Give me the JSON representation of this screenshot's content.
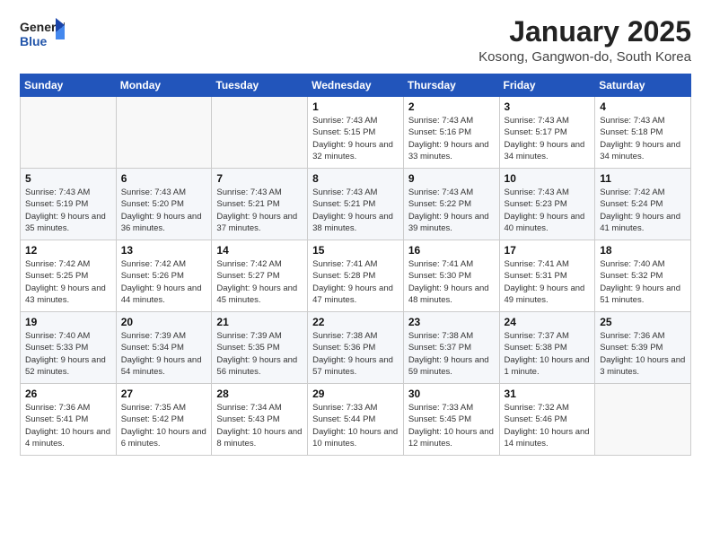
{
  "header": {
    "logo_general": "General",
    "logo_blue": "Blue",
    "title": "January 2025",
    "subtitle": "Kosong, Gangwon-do, South Korea"
  },
  "weekdays": [
    "Sunday",
    "Monday",
    "Tuesday",
    "Wednesday",
    "Thursday",
    "Friday",
    "Saturday"
  ],
  "weeks": [
    [
      {
        "day": "",
        "info": ""
      },
      {
        "day": "",
        "info": ""
      },
      {
        "day": "",
        "info": ""
      },
      {
        "day": "1",
        "info": "Sunrise: 7:43 AM\nSunset: 5:15 PM\nDaylight: 9 hours and 32 minutes."
      },
      {
        "day": "2",
        "info": "Sunrise: 7:43 AM\nSunset: 5:16 PM\nDaylight: 9 hours and 33 minutes."
      },
      {
        "day": "3",
        "info": "Sunrise: 7:43 AM\nSunset: 5:17 PM\nDaylight: 9 hours and 34 minutes."
      },
      {
        "day": "4",
        "info": "Sunrise: 7:43 AM\nSunset: 5:18 PM\nDaylight: 9 hours and 34 minutes."
      }
    ],
    [
      {
        "day": "5",
        "info": "Sunrise: 7:43 AM\nSunset: 5:19 PM\nDaylight: 9 hours and 35 minutes."
      },
      {
        "day": "6",
        "info": "Sunrise: 7:43 AM\nSunset: 5:20 PM\nDaylight: 9 hours and 36 minutes."
      },
      {
        "day": "7",
        "info": "Sunrise: 7:43 AM\nSunset: 5:21 PM\nDaylight: 9 hours and 37 minutes."
      },
      {
        "day": "8",
        "info": "Sunrise: 7:43 AM\nSunset: 5:21 PM\nDaylight: 9 hours and 38 minutes."
      },
      {
        "day": "9",
        "info": "Sunrise: 7:43 AM\nSunset: 5:22 PM\nDaylight: 9 hours and 39 minutes."
      },
      {
        "day": "10",
        "info": "Sunrise: 7:43 AM\nSunset: 5:23 PM\nDaylight: 9 hours and 40 minutes."
      },
      {
        "day": "11",
        "info": "Sunrise: 7:42 AM\nSunset: 5:24 PM\nDaylight: 9 hours and 41 minutes."
      }
    ],
    [
      {
        "day": "12",
        "info": "Sunrise: 7:42 AM\nSunset: 5:25 PM\nDaylight: 9 hours and 43 minutes."
      },
      {
        "day": "13",
        "info": "Sunrise: 7:42 AM\nSunset: 5:26 PM\nDaylight: 9 hours and 44 minutes."
      },
      {
        "day": "14",
        "info": "Sunrise: 7:42 AM\nSunset: 5:27 PM\nDaylight: 9 hours and 45 minutes."
      },
      {
        "day": "15",
        "info": "Sunrise: 7:41 AM\nSunset: 5:28 PM\nDaylight: 9 hours and 47 minutes."
      },
      {
        "day": "16",
        "info": "Sunrise: 7:41 AM\nSunset: 5:30 PM\nDaylight: 9 hours and 48 minutes."
      },
      {
        "day": "17",
        "info": "Sunrise: 7:41 AM\nSunset: 5:31 PM\nDaylight: 9 hours and 49 minutes."
      },
      {
        "day": "18",
        "info": "Sunrise: 7:40 AM\nSunset: 5:32 PM\nDaylight: 9 hours and 51 minutes."
      }
    ],
    [
      {
        "day": "19",
        "info": "Sunrise: 7:40 AM\nSunset: 5:33 PM\nDaylight: 9 hours and 52 minutes."
      },
      {
        "day": "20",
        "info": "Sunrise: 7:39 AM\nSunset: 5:34 PM\nDaylight: 9 hours and 54 minutes."
      },
      {
        "day": "21",
        "info": "Sunrise: 7:39 AM\nSunset: 5:35 PM\nDaylight: 9 hours and 56 minutes."
      },
      {
        "day": "22",
        "info": "Sunrise: 7:38 AM\nSunset: 5:36 PM\nDaylight: 9 hours and 57 minutes."
      },
      {
        "day": "23",
        "info": "Sunrise: 7:38 AM\nSunset: 5:37 PM\nDaylight: 9 hours and 59 minutes."
      },
      {
        "day": "24",
        "info": "Sunrise: 7:37 AM\nSunset: 5:38 PM\nDaylight: 10 hours and 1 minute."
      },
      {
        "day": "25",
        "info": "Sunrise: 7:36 AM\nSunset: 5:39 PM\nDaylight: 10 hours and 3 minutes."
      }
    ],
    [
      {
        "day": "26",
        "info": "Sunrise: 7:36 AM\nSunset: 5:41 PM\nDaylight: 10 hours and 4 minutes."
      },
      {
        "day": "27",
        "info": "Sunrise: 7:35 AM\nSunset: 5:42 PM\nDaylight: 10 hours and 6 minutes."
      },
      {
        "day": "28",
        "info": "Sunrise: 7:34 AM\nSunset: 5:43 PM\nDaylight: 10 hours and 8 minutes."
      },
      {
        "day": "29",
        "info": "Sunrise: 7:33 AM\nSunset: 5:44 PM\nDaylight: 10 hours and 10 minutes."
      },
      {
        "day": "30",
        "info": "Sunrise: 7:33 AM\nSunset: 5:45 PM\nDaylight: 10 hours and 12 minutes."
      },
      {
        "day": "31",
        "info": "Sunrise: 7:32 AM\nSunset: 5:46 PM\nDaylight: 10 hours and 14 minutes."
      },
      {
        "day": "",
        "info": ""
      }
    ]
  ]
}
